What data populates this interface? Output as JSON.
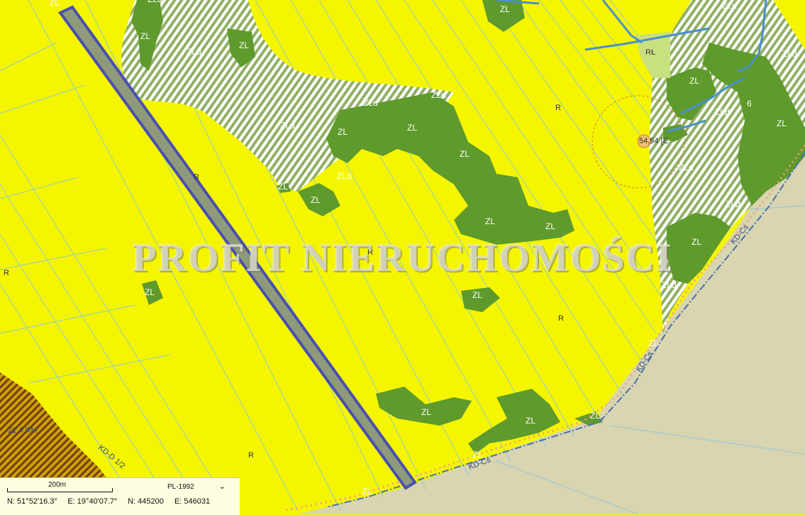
{
  "watermark": "PROFIT NIERUCHOMOŚCI",
  "colors": {
    "agricultural": "#f5f500",
    "forest": "#5e9a2c",
    "forest_planned_hatch": "#8fb064",
    "road_area": "#d8d5b0",
    "parcel_highlight": "#8f9a7a",
    "parcel_outline": "#4a4fb0",
    "parcel_lines": "#7fc7e8",
    "water": "#4a90c8",
    "boundary_dots": "#f0a080"
  },
  "map_labels": {
    "ZL": "ZL",
    "ZLd": "ZLd",
    "R": "R",
    "RL": "RŁ",
    "RM": "21.4 RM",
    "KD": "KD-Cs",
    "KD2": "KD-D 1/2",
    "six": "6",
    "circle_label": "54,54 [E"
  },
  "footer": {
    "scale_label": "200m",
    "crs_value": "PL-1992",
    "crs_icon": "chevron-down-icon",
    "coords": {
      "lat": "N: 51°52′16.3″",
      "lon": "E: 19°40′07.7″",
      "north": "N: 445200",
      "east": "E: 546031"
    }
  }
}
